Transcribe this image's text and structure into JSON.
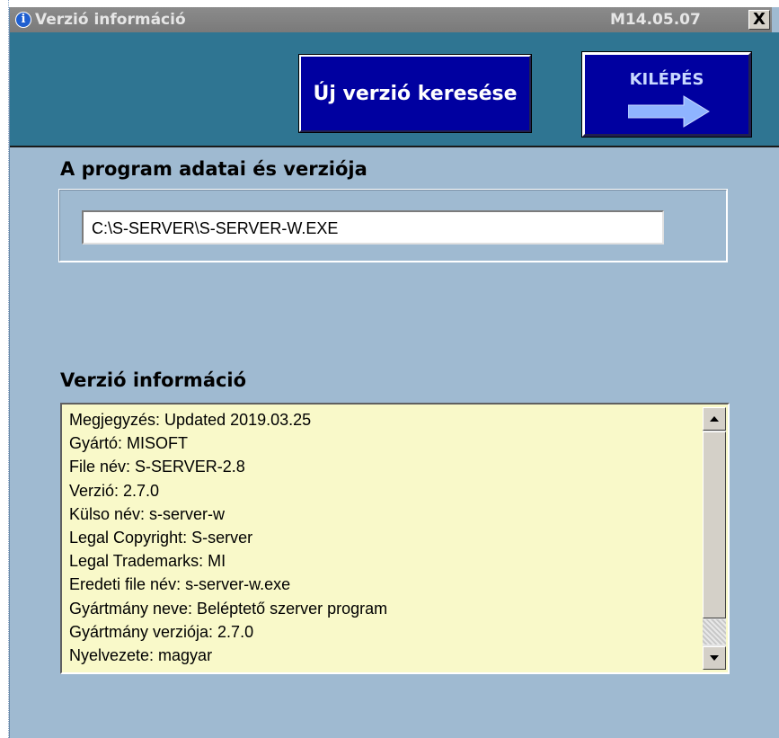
{
  "window": {
    "title": "Verzió információ",
    "version_tag": "M14.05.07",
    "close_glyph": "X",
    "info_glyph": "i"
  },
  "toolbar": {
    "search_button_label": "Új verzió keresése",
    "exit_button_label": "KILÉPÉS",
    "exit_icon": "right-arrow-icon"
  },
  "program": {
    "section_title": "A program adatai és verziója",
    "path": "C:\\S-SERVER\\S-SERVER-W.EXE"
  },
  "version_info": {
    "section_title": "Verzió információ",
    "lines": [
      "Megjegyzés: Updated 2019.03.25",
      "Gyártó: MISOFT",
      "File név: S-SERVER-2.8",
      "Verzió: 2.7.0",
      "Külso név: s-server-w",
      "Legal Copyright: S-server",
      "Legal Trademarks: MI",
      "Eredeti file név: s-server-w.exe",
      "Gyártmány neve: Beléptető szerver program",
      "Gyártmány verziója: 2.7.0",
      "Nyelvezete: magyar"
    ]
  },
  "colors": {
    "window_bg": "#9fbad1",
    "toolbar_bg": "#2f7592",
    "button_bg": "#0000a0",
    "info_bg": "#f9f9c9",
    "titlebar_bg": "#808080"
  }
}
